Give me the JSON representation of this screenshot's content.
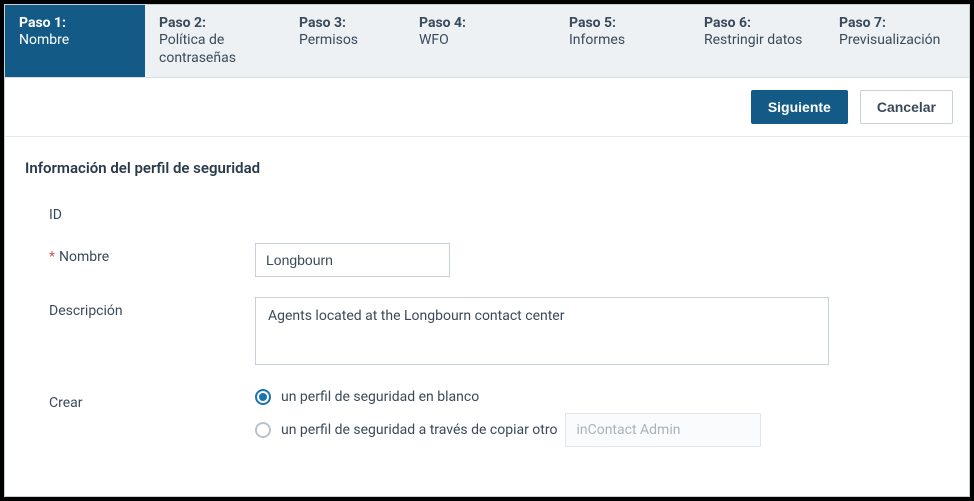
{
  "steps": [
    {
      "title": "Paso 1:",
      "subtitle": "Nombre"
    },
    {
      "title": "Paso 2:",
      "subtitle": "Política de contraseñas"
    },
    {
      "title": "Paso 3:",
      "subtitle": "Permisos"
    },
    {
      "title": "Paso 4:",
      "subtitle": "WFO"
    },
    {
      "title": "Paso 5:",
      "subtitle": "Informes"
    },
    {
      "title": "Paso 6:",
      "subtitle": "Restringir datos"
    },
    {
      "title": "Paso 7:",
      "subtitle": "Previsualización"
    }
  ],
  "actions": {
    "next": "Siguiente",
    "cancel": "Cancelar"
  },
  "section": {
    "title": "Información del perfil de seguridad",
    "id_label": "ID",
    "id_value": "",
    "name_label": "Nombre",
    "name_value": "Longbourn",
    "description_label": "Descripción",
    "description_value": "Agents located at the Longbourn contact center",
    "create_label": "Crear",
    "create_options": {
      "blank": "un perfil de seguridad en blanco",
      "copy": "un perfil de seguridad a través de copiar otro",
      "copy_placeholder": "inContact Admin"
    }
  }
}
